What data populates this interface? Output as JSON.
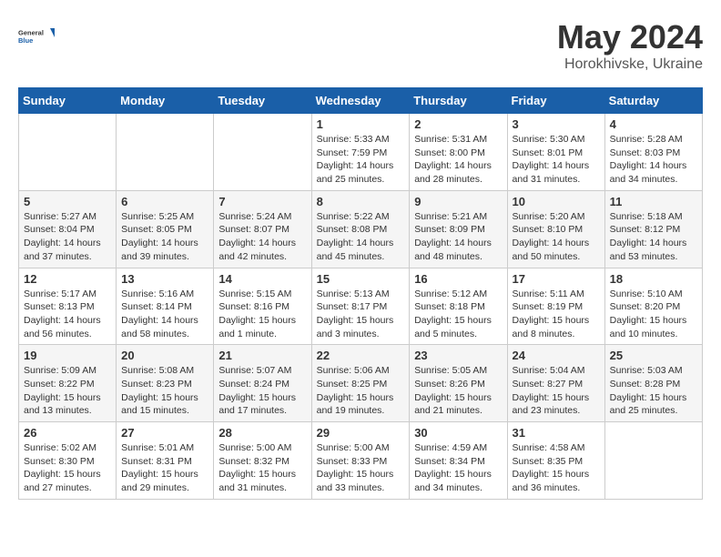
{
  "header": {
    "logo_general": "General",
    "logo_blue": "Blue",
    "title_month": "May 2024",
    "title_location": "Horokhivske, Ukraine"
  },
  "calendar": {
    "days_of_week": [
      "Sunday",
      "Monday",
      "Tuesday",
      "Wednesday",
      "Thursday",
      "Friday",
      "Saturday"
    ],
    "weeks": [
      [
        {
          "day": "",
          "info": ""
        },
        {
          "day": "",
          "info": ""
        },
        {
          "day": "",
          "info": ""
        },
        {
          "day": "1",
          "info": "Sunrise: 5:33 AM\nSunset: 7:59 PM\nDaylight: 14 hours and 25 minutes."
        },
        {
          "day": "2",
          "info": "Sunrise: 5:31 AM\nSunset: 8:00 PM\nDaylight: 14 hours and 28 minutes."
        },
        {
          "day": "3",
          "info": "Sunrise: 5:30 AM\nSunset: 8:01 PM\nDaylight: 14 hours and 31 minutes."
        },
        {
          "day": "4",
          "info": "Sunrise: 5:28 AM\nSunset: 8:03 PM\nDaylight: 14 hours and 34 minutes."
        }
      ],
      [
        {
          "day": "5",
          "info": "Sunrise: 5:27 AM\nSunset: 8:04 PM\nDaylight: 14 hours and 37 minutes."
        },
        {
          "day": "6",
          "info": "Sunrise: 5:25 AM\nSunset: 8:05 PM\nDaylight: 14 hours and 39 minutes."
        },
        {
          "day": "7",
          "info": "Sunrise: 5:24 AM\nSunset: 8:07 PM\nDaylight: 14 hours and 42 minutes."
        },
        {
          "day": "8",
          "info": "Sunrise: 5:22 AM\nSunset: 8:08 PM\nDaylight: 14 hours and 45 minutes."
        },
        {
          "day": "9",
          "info": "Sunrise: 5:21 AM\nSunset: 8:09 PM\nDaylight: 14 hours and 48 minutes."
        },
        {
          "day": "10",
          "info": "Sunrise: 5:20 AM\nSunset: 8:10 PM\nDaylight: 14 hours and 50 minutes."
        },
        {
          "day": "11",
          "info": "Sunrise: 5:18 AM\nSunset: 8:12 PM\nDaylight: 14 hours and 53 minutes."
        }
      ],
      [
        {
          "day": "12",
          "info": "Sunrise: 5:17 AM\nSunset: 8:13 PM\nDaylight: 14 hours and 56 minutes."
        },
        {
          "day": "13",
          "info": "Sunrise: 5:16 AM\nSunset: 8:14 PM\nDaylight: 14 hours and 58 minutes."
        },
        {
          "day": "14",
          "info": "Sunrise: 5:15 AM\nSunset: 8:16 PM\nDaylight: 15 hours and 1 minute."
        },
        {
          "day": "15",
          "info": "Sunrise: 5:13 AM\nSunset: 8:17 PM\nDaylight: 15 hours and 3 minutes."
        },
        {
          "day": "16",
          "info": "Sunrise: 5:12 AM\nSunset: 8:18 PM\nDaylight: 15 hours and 5 minutes."
        },
        {
          "day": "17",
          "info": "Sunrise: 5:11 AM\nSunset: 8:19 PM\nDaylight: 15 hours and 8 minutes."
        },
        {
          "day": "18",
          "info": "Sunrise: 5:10 AM\nSunset: 8:20 PM\nDaylight: 15 hours and 10 minutes."
        }
      ],
      [
        {
          "day": "19",
          "info": "Sunrise: 5:09 AM\nSunset: 8:22 PM\nDaylight: 15 hours and 13 minutes."
        },
        {
          "day": "20",
          "info": "Sunrise: 5:08 AM\nSunset: 8:23 PM\nDaylight: 15 hours and 15 minutes."
        },
        {
          "day": "21",
          "info": "Sunrise: 5:07 AM\nSunset: 8:24 PM\nDaylight: 15 hours and 17 minutes."
        },
        {
          "day": "22",
          "info": "Sunrise: 5:06 AM\nSunset: 8:25 PM\nDaylight: 15 hours and 19 minutes."
        },
        {
          "day": "23",
          "info": "Sunrise: 5:05 AM\nSunset: 8:26 PM\nDaylight: 15 hours and 21 minutes."
        },
        {
          "day": "24",
          "info": "Sunrise: 5:04 AM\nSunset: 8:27 PM\nDaylight: 15 hours and 23 minutes."
        },
        {
          "day": "25",
          "info": "Sunrise: 5:03 AM\nSunset: 8:28 PM\nDaylight: 15 hours and 25 minutes."
        }
      ],
      [
        {
          "day": "26",
          "info": "Sunrise: 5:02 AM\nSunset: 8:30 PM\nDaylight: 15 hours and 27 minutes."
        },
        {
          "day": "27",
          "info": "Sunrise: 5:01 AM\nSunset: 8:31 PM\nDaylight: 15 hours and 29 minutes."
        },
        {
          "day": "28",
          "info": "Sunrise: 5:00 AM\nSunset: 8:32 PM\nDaylight: 15 hours and 31 minutes."
        },
        {
          "day": "29",
          "info": "Sunrise: 5:00 AM\nSunset: 8:33 PM\nDaylight: 15 hours and 33 minutes."
        },
        {
          "day": "30",
          "info": "Sunrise: 4:59 AM\nSunset: 8:34 PM\nDaylight: 15 hours and 34 minutes."
        },
        {
          "day": "31",
          "info": "Sunrise: 4:58 AM\nSunset: 8:35 PM\nDaylight: 15 hours and 36 minutes."
        },
        {
          "day": "",
          "info": ""
        }
      ]
    ]
  }
}
